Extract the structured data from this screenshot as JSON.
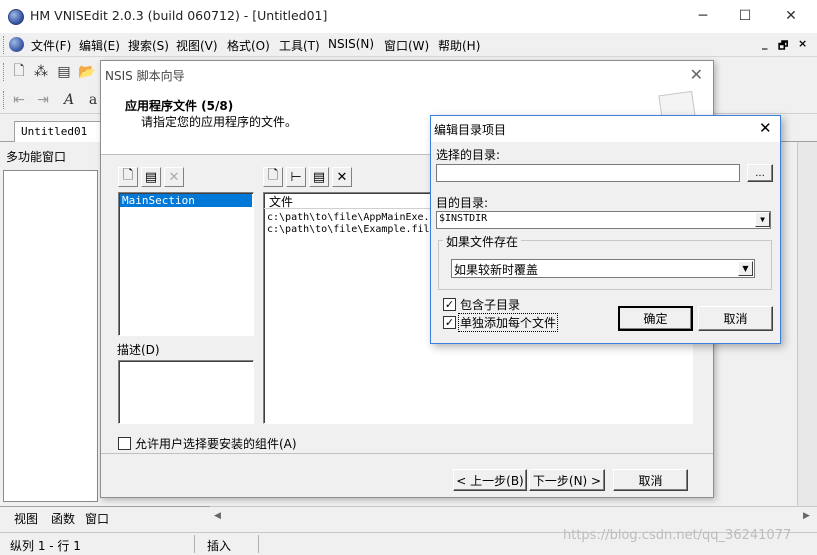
{
  "app": {
    "title": "HM VNISEdit 2.0.3 (build 060712) - [Untitled01]",
    "minimize": "─",
    "maximize": "☐",
    "close": "✕"
  },
  "menu": {
    "items": [
      "文件(F)",
      "编辑(E)",
      "搜索(S)",
      "视图(V)",
      "格式(O)",
      "工具(T)",
      "NSIS(N)",
      "窗口(W)",
      "帮助(H)"
    ],
    "mdi_minimize": "_",
    "mdi_restore": "🗗",
    "mdi_close": "×"
  },
  "doc_tab": "Untitled01",
  "side_panel": {
    "title": "多功能窗口",
    "tabs": [
      "视图",
      "函数",
      "窗口"
    ]
  },
  "status": {
    "position": "纵列 1 - 行 1",
    "mode": "插入"
  },
  "wizard": {
    "title": "NSIS 脚本向导",
    "heading": "应用程序文件 (5/8)",
    "subheading": "请指定您的应用程序的文件。",
    "sections_list": [
      "MainSection"
    ],
    "desc_label": "描述(D)",
    "files_header": "文件",
    "files": [
      "c:\\path\\to\\file\\AppMainExe.",
      "c:\\path\\to\\file\\Example.fil"
    ],
    "allow_select_label": "允许用户选择要安装的组件(A)",
    "allow_select_checked": false,
    "back_button": "< 上一步(B)",
    "next_button": "下一步(N) >",
    "cancel_button": "取消"
  },
  "edit_dialog": {
    "title": "编辑目录项目",
    "source_label": "选择的目录:",
    "source_value": "",
    "browse_button": "...",
    "dest_label": "目的目录:",
    "dest_value": "$INSTDIR",
    "overwrite_group": "如果文件存在",
    "overwrite_value": "如果较新时覆盖",
    "include_subdirs_label": "包含子目录",
    "include_subdirs_checked": true,
    "add_each_label": "单独添加每个文件",
    "add_each_checked": true,
    "ok_button": "确定",
    "cancel_button": "取消",
    "close": "✕"
  },
  "watermark": "https://blog.csdn.net/qq_36241077"
}
